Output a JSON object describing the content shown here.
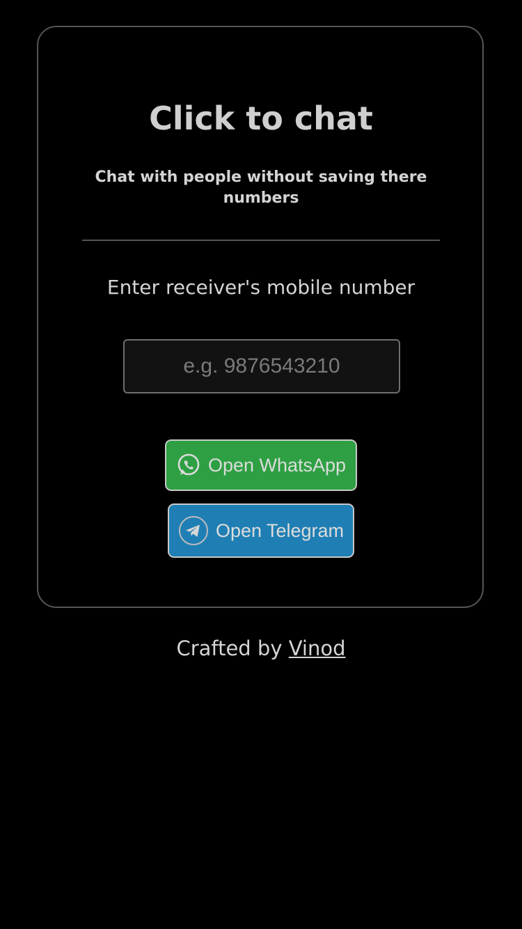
{
  "card": {
    "title": "Click to chat",
    "subtitle": "Chat with people without saving there numbers",
    "prompt": "Enter receiver's mobile number",
    "phone_placeholder": "e.g. 9876543210",
    "phone_value": ""
  },
  "buttons": {
    "whatsapp_label": "Open WhatsApp",
    "whatsapp_icon": "whatsapp-icon",
    "telegram_label": "Open Telegram",
    "telegram_icon": "telegram-icon"
  },
  "footer": {
    "prefix": "Crafted by",
    "author_link": "Vinod"
  },
  "colors": {
    "background": "#000000",
    "whatsapp_green": "#2ea043",
    "telegram_blue": "#1f7fb4",
    "text": "#d4d4d4"
  }
}
